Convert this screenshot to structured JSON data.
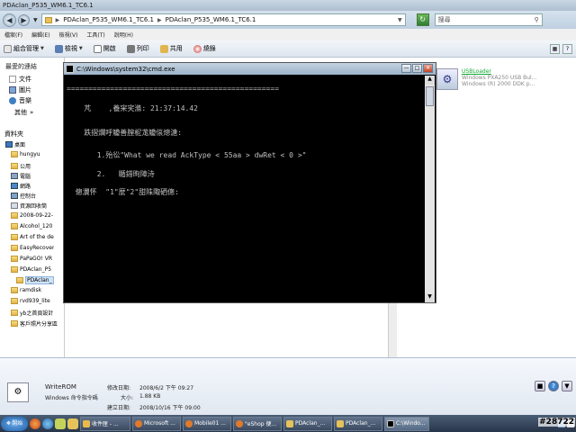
{
  "explorer": {
    "title": "PDAclan_P535_WM6.1_TC6.1",
    "address": [
      "PDAclan_P535_WM6.1_TC6.1",
      "PDAclan_P535_WM6.1_TC6.1"
    ],
    "search_placeholder": "搜尋",
    "menu": [
      "檔案(F)",
      "編輯(E)",
      "檢視(V)",
      "工具(T)",
      "說明(H)"
    ],
    "toolbar": {
      "organize": "組合管理",
      "views": "檢視",
      "open": "開啟",
      "print": "列印",
      "share": "共用",
      "burn": "燒錄"
    }
  },
  "left_nav": {
    "favorites_title": "最愛的連結",
    "favorites": [
      "文件",
      "圖片",
      "音樂"
    ],
    "more": "其他",
    "folders_title": "資料夾",
    "tree": [
      "桌面",
      "hungyu",
      "公用",
      "電腦",
      "網路",
      "控制台",
      "資源回收筒",
      "2008-09-22-",
      "Alcohol_120",
      "Art of the de",
      "EasyRecover",
      "PaPaGO! VR",
      "PDAclan_P5",
      "PDAclan_",
      "ramdisk",
      "rvd939_lite",
      "yb之首頁設計",
      "客戶照片分享區"
    ]
  },
  "file_item": {
    "name": "USBLoader",
    "line1": "Windows PXA250 USB Bul...",
    "line2": "Windows (R) 2000 DDK p..."
  },
  "details": {
    "name": "WriteROM",
    "type": "Windows 命令指令碼",
    "modified_label": "修改日期:",
    "modified_value": "2008/6/2 下午 09:27",
    "size_label": "大小:",
    "size_value": "1.88 KB",
    "created_label": "建立日期:",
    "created_value": "2008/10/16 下午 09:00"
  },
  "cmd": {
    "title": "C:\\Windows\\system32\\cmd.exe",
    "lines": [
      "=================================================",
      "    芃    ,養宩宎滌: 21:37:14.42",
      "    跌摺爛呼觼善膣柅尨觼偯熜溏:",
      "       1.殆彸\"What we read AckType < 55aa > dwRet < 0 >\"",
      "       2.   瞃錯昫陣洔",
      "  傯瀷怀  \"1\"麼\"2\"甜陎陬硒傯:"
    ]
  },
  "taskbar": {
    "start": "開始",
    "tasks": [
      "收件匣 - ...",
      "Microsoft ...",
      "Mobile01 ...",
      "\"eShop 便...",
      "PDAclan_...",
      "PDAclan_...",
      "C:\\Windo..."
    ]
  },
  "watermark": "#28722"
}
